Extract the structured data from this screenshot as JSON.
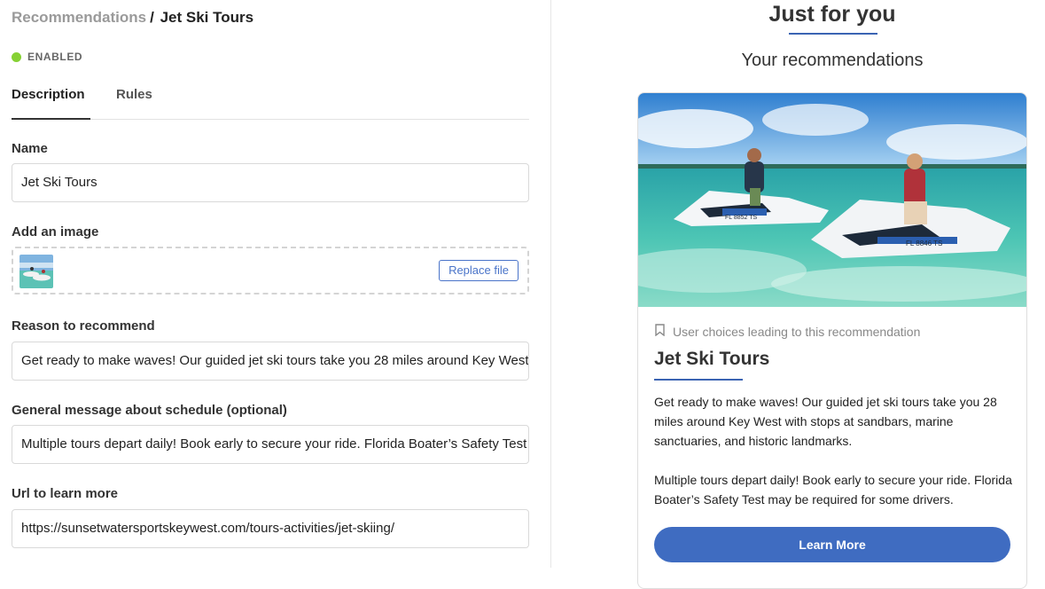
{
  "breadcrumb": {
    "parent": "Recommendations",
    "separator": "/",
    "current": "Jet Ski Tours"
  },
  "status": {
    "label": "ENABLED",
    "color": "#86d134"
  },
  "tabs": [
    {
      "label": "Description",
      "active": true
    },
    {
      "label": "Rules",
      "active": false
    }
  ],
  "form": {
    "name": {
      "label": "Name",
      "value": "Jet Ski Tours"
    },
    "image": {
      "label": "Add an image",
      "button": "Replace file"
    },
    "reason": {
      "label": "Reason to recommend",
      "value": "Get ready to make waves! Our guided jet ski tours take you 28 miles around Key West with stops at sandbars, marine sanctuaries, and historic landmarks."
    },
    "schedule": {
      "label": "General message about schedule (optional)",
      "value": "Multiple tours depart daily! Book early to secure your ride. Florida Boater’s Safety Test may be required for some drivers."
    },
    "url": {
      "label": "Url to learn more",
      "value": "https://sunsetwatersportskeywest.com/tours-activities/jet-skiing/"
    }
  },
  "preview": {
    "title": "Just for you",
    "subtitle": "Your recommendations",
    "card": {
      "choices_text": "User choices leading to this recommendation",
      "title": "Jet Ski Tours",
      "paragraph1": "Get ready to make waves! Our guided jet ski tours take you 28 miles around Key West with stops at sandbars, marine sanctuaries, and historic landmarks.",
      "paragraph2": "Multiple tours depart daily! Book early to secure your ride. Florida Boater’s Safety Test may be required for some drivers.",
      "button": "Learn More",
      "jetski_plates": [
        "FL 8852 TS",
        "FL 8846 TS"
      ]
    }
  },
  "colors": {
    "accent": "#3f6cc1",
    "underline": "#3b64b3"
  },
  "icons": {
    "bookmark": "bookmark-icon"
  }
}
